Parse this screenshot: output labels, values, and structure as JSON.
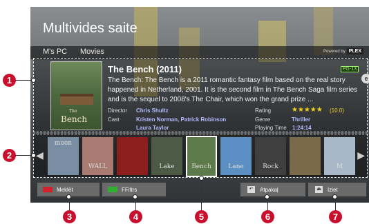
{
  "app": {
    "title": "Multivides saite"
  },
  "nav": {
    "items": [
      "M's PC",
      "Movies"
    ],
    "powered_by": "Powered by",
    "brand": "PLEX"
  },
  "movie": {
    "title": "The Bench (2011)",
    "content_rating": "PG-13",
    "synopsis": "The Bench: The Bench is a 2011 romantic fantasy film based on the real story happened in Netherland, 2001. It is the second film in The Bench Saga film series and is the sequel to 2008's The Chair, which won the grand prize ...",
    "director_label": "Director",
    "director": "Chris Shultz",
    "cast_label": "Cast",
    "cast_line1": "Kristen Norman, Patrick Robinson",
    "cast_line2": "Laura Taylor",
    "rating_label": "Rating",
    "rating_stars": "★★★★★",
    "rating_value": "(10.0)",
    "rating_fraction": 1.0,
    "genre_label": "Genre",
    "genre": "Thriller",
    "playtime_label": "Playing Time",
    "playtime": "1:24:14",
    "poster_text_small": "The",
    "poster_text": "Bench"
  },
  "thumbnails": [
    {
      "label": "moon",
      "bg": "#7a8ea3"
    },
    {
      "label": "WALL",
      "bg": "#a87a72"
    },
    {
      "label": "",
      "bg": "#8c1e1e"
    },
    {
      "label": "Lake",
      "bg": "#4d5a45"
    },
    {
      "label": "Bench",
      "bg": "#5d7a4a",
      "selected": true
    },
    {
      "label": "Lane",
      "bg": "#5c8fc4"
    },
    {
      "label": "Rock",
      "bg": "#3f3f3f"
    },
    {
      "label": "",
      "bg": "#7a6a4a"
    },
    {
      "label": "M",
      "bg": "#a8b8c8"
    }
  ],
  "buttons": {
    "search": "Meklēt",
    "filter": "FFiltrs",
    "back": "Atpakaļ",
    "exit": "Iziet",
    "search_color": "#d4202a",
    "filter_color": "#2fae2f"
  },
  "callouts": [
    "1",
    "2",
    "3",
    "4",
    "5",
    "6",
    "7"
  ]
}
